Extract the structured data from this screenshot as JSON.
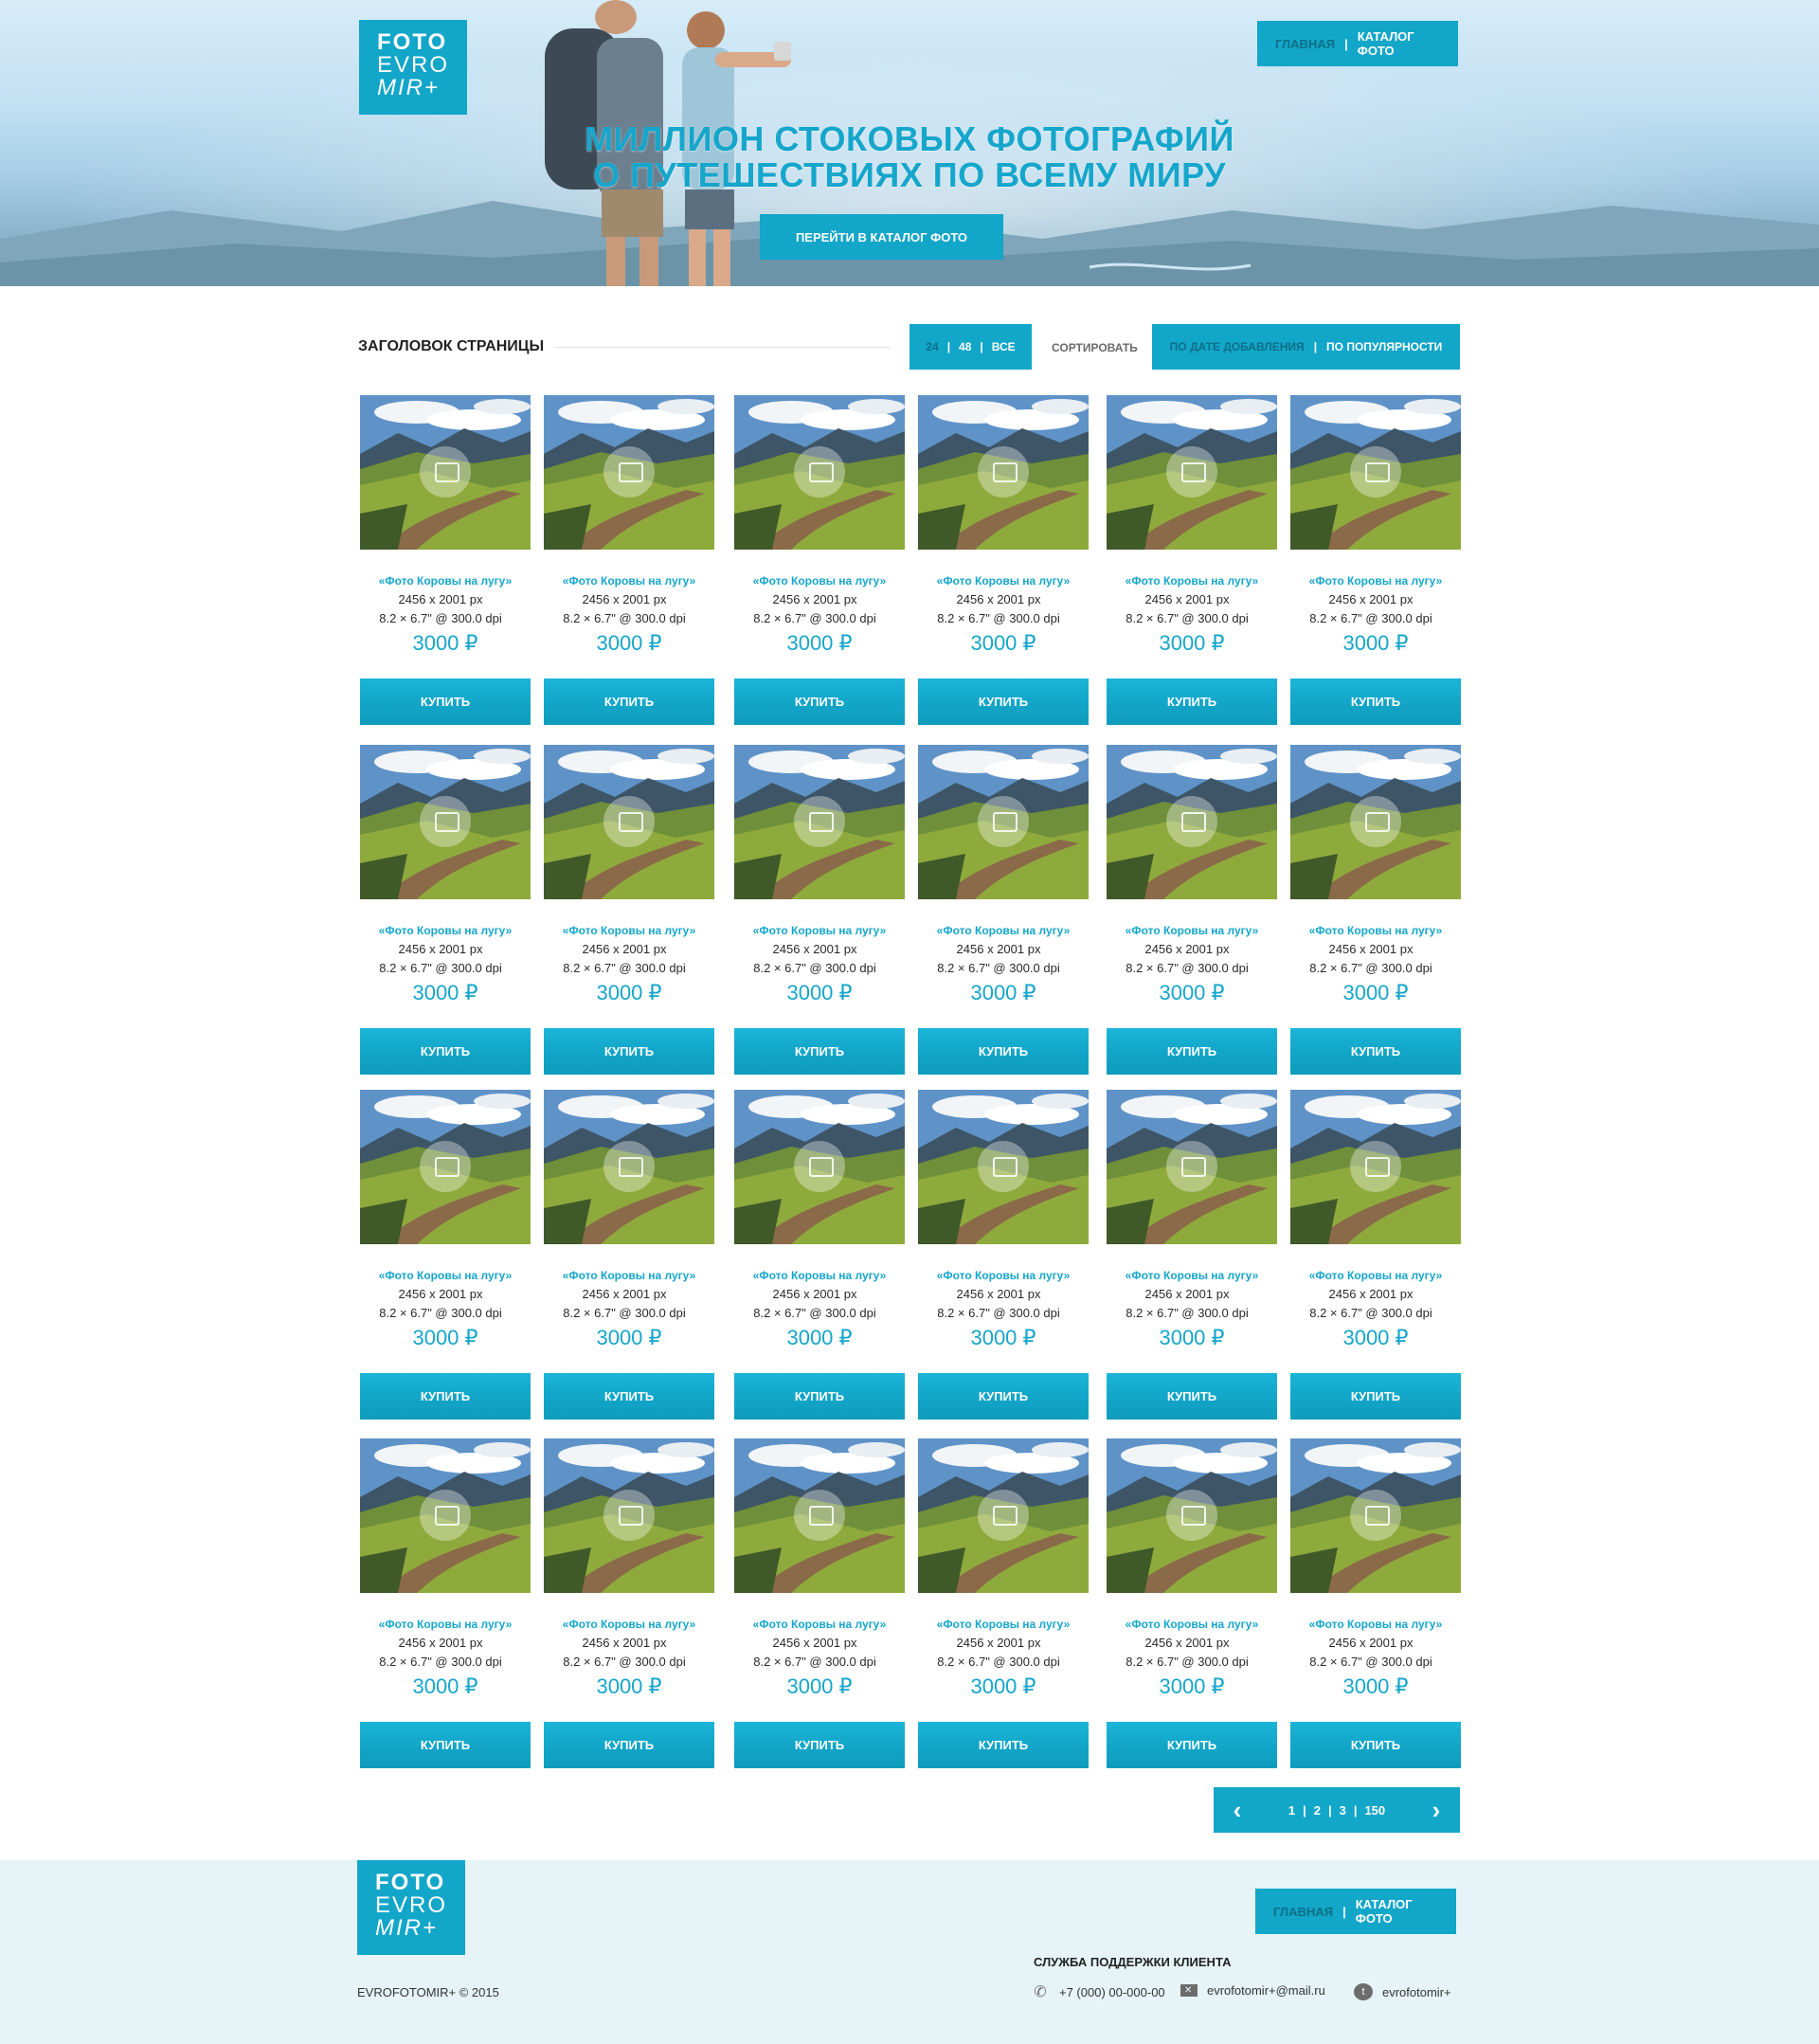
{
  "brand": {
    "line1": "FOTO",
    "line2": "EVRO",
    "line3": "MIR+"
  },
  "nav": {
    "home": "ГЛАВНАЯ",
    "separator": "|",
    "catalog": "КАТАЛОГ ФОТО"
  },
  "hero": {
    "headline_line1": "МИЛЛИОН СТОКОВЫХ ФОТОГРАФИЙ",
    "headline_line2": "О ПУТЕШЕСТВИЯХ ПО ВСЕМУ МИРУ",
    "cta": "ПЕРЕЙТИ В КАТАЛОГ ФОТО"
  },
  "toolbar": {
    "page_title": "ЗАГОЛОВОК СТРАНИЦЫ",
    "perpage": [
      "24",
      "48",
      "ВСЕ"
    ],
    "sort_label": "СОРТИРОВАТЬ",
    "sort_options": [
      "ПО ДАТЕ ДОБАВЛЕНИЯ",
      "ПО ПОПУЛЯРНОСТИ"
    ]
  },
  "product": {
    "name": "«Фото Коровы на лугу»",
    "dims": "2456 x 2001 px",
    "dpi": "8.2 × 6.7\" @ 300.0 dpi",
    "price": "3000 ₽",
    "buy": "КУПИТЬ"
  },
  "grid": {
    "rows": 4,
    "columns": 6
  },
  "pagination": {
    "pages": [
      "1",
      "2",
      "3",
      "150"
    ],
    "prev_icon": "chevron-left-icon",
    "next_icon": "chevron-right-icon"
  },
  "footer": {
    "copyright": "EVROFOTOMIR+ © 2015",
    "support_title": "СЛУЖБА ПОДДЕРЖКИ КЛИЕНТА",
    "phone": "+7 (000) 00-000-00",
    "email": "evrofotomir+@mail.ru",
    "twitter": "evrofotomir+"
  },
  "colors": {
    "accent": "#12a6c9",
    "accent_dark": "#0d6f86",
    "footer_bg": "#e6f4f8"
  }
}
